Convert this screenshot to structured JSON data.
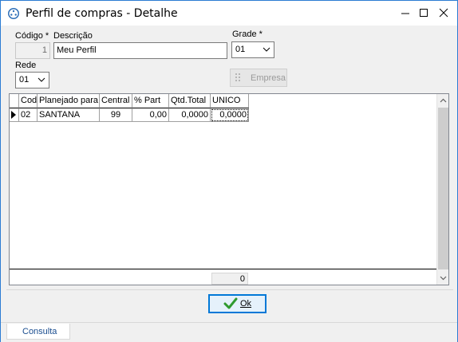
{
  "window": {
    "title": "Perfil de compras - Detalhe"
  },
  "form": {
    "codigo_label": "Código *",
    "codigo_value": "1",
    "descricao_label": "Descrição",
    "descricao_value": "Meu Perfil",
    "grade_label": "Grade *",
    "grade_value": "01",
    "rede_label": "Rede",
    "rede_value": "01",
    "empresa_button": "Empresa"
  },
  "grid": {
    "columns": [
      "Cod",
      "Planejado para",
      "Central",
      "% Part",
      "Qtd.Total",
      "UNICO"
    ],
    "rows": [
      [
        "02",
        "SANTANA",
        "99",
        "0,00",
        "0,0000",
        "0,0000"
      ]
    ],
    "footer_total": "0"
  },
  "actions": {
    "ok_label": "Ok"
  },
  "status": {
    "tab_label": "Consulta"
  },
  "colors": {
    "window_border": "#2b7cd3",
    "ok_border": "#0078d7",
    "tab_text": "#1a4d8f",
    "check_icon": "#2f9a2f"
  }
}
